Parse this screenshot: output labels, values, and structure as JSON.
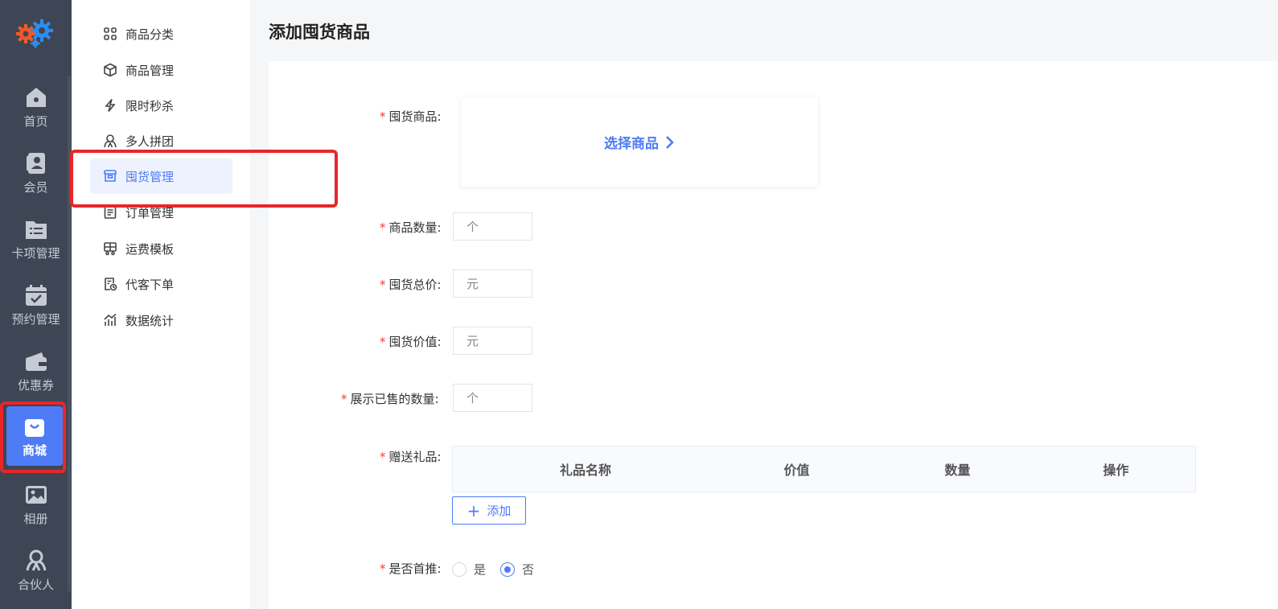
{
  "rail": {
    "items": [
      {
        "label": "首页",
        "icon": "home-icon"
      },
      {
        "label": "会员",
        "icon": "member-icon"
      },
      {
        "label": "卡项管理",
        "icon": "folder-list-icon"
      },
      {
        "label": "预约管理",
        "icon": "calendar-check-icon"
      },
      {
        "label": "优惠券",
        "icon": "wallet-icon"
      },
      {
        "label": "商城",
        "icon": "shopping-bag-icon",
        "active": true
      },
      {
        "label": "相册",
        "icon": "image-icon"
      },
      {
        "label": "合伙人",
        "icon": "partner-icon"
      }
    ]
  },
  "submenu": {
    "items": [
      {
        "label": "商品分类",
        "icon": "grid-icon"
      },
      {
        "label": "商品管理",
        "icon": "cube-icon"
      },
      {
        "label": "限时秒杀",
        "icon": "lightning-icon"
      },
      {
        "label": "多人拼团",
        "icon": "group-icon"
      },
      {
        "label": "囤货管理",
        "icon": "stock-icon",
        "active": true
      },
      {
        "label": "订单管理",
        "icon": "order-icon"
      },
      {
        "label": "运费模板",
        "icon": "truck-icon"
      },
      {
        "label": "代客下单",
        "icon": "receipt-icon"
      },
      {
        "label": "数据统计",
        "icon": "chart-icon"
      }
    ]
  },
  "page": {
    "title": "添加囤货商品"
  },
  "form": {
    "required_mark": "*",
    "goods_label": "囤货商品:",
    "pick_label": "选择商品",
    "qty_label": "商品数量:",
    "qty_placeholder": "个",
    "total_label": "囤货总价:",
    "total_placeholder": "元",
    "value_label": "囤货价值:",
    "value_placeholder": "元",
    "sold_label": "展示已售的数量:",
    "sold_placeholder": "个",
    "gift_label": "赠送礼品:",
    "gift_columns": [
      "礼品名称",
      "价值",
      "数量",
      "操作"
    ],
    "add_plus": "+",
    "add_label": "添加",
    "home_label": "是否首推:",
    "home_options": [
      {
        "label": "是",
        "checked": false
      },
      {
        "label": "否",
        "checked": true
      }
    ]
  },
  "colors": {
    "accent": "#4d7cf6",
    "rail_bg": "#3e4656",
    "highlight": "#e8262a",
    "required": "#f23c3c"
  }
}
